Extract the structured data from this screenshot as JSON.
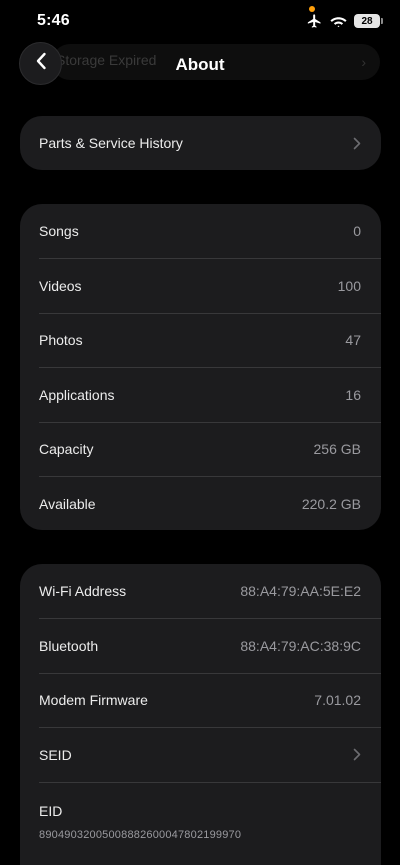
{
  "status_bar": {
    "time": "5:46",
    "battery_level": "28",
    "icons": [
      "airplane-icon",
      "wifi-icon",
      "battery-icon"
    ]
  },
  "nav": {
    "title": "About",
    "ghost_text": "Storage Expired",
    "back_icon": "chevron-left-icon"
  },
  "service_card": {
    "label": "Parts & Service History"
  },
  "media_card": {
    "rows": [
      {
        "label": "Songs",
        "value": "0"
      },
      {
        "label": "Videos",
        "value": "100"
      },
      {
        "label": "Photos",
        "value": "47"
      },
      {
        "label": "Applications",
        "value": "16"
      },
      {
        "label": "Capacity",
        "value": "256 GB"
      },
      {
        "label": "Available",
        "value": "220.2 GB"
      }
    ]
  },
  "network_card": {
    "wifi": {
      "label": "Wi-Fi Address",
      "value": "88:A4:79:AA:5E:E2"
    },
    "bluetooth": {
      "label": "Bluetooth",
      "value": "88:A4:79:AC:38:9C"
    },
    "modem": {
      "label": "Modem Firmware",
      "value": "7.01.02"
    },
    "seid": {
      "label": "SEID"
    },
    "eid": {
      "label": "EID",
      "value": "89049032005008882600047802199970"
    }
  },
  "colors": {
    "background": "#000000",
    "card": "#1c1c1e",
    "separator": "#38383a",
    "secondary_text": "#9a9a9f",
    "privacy_dot": "#ff9f0a"
  }
}
